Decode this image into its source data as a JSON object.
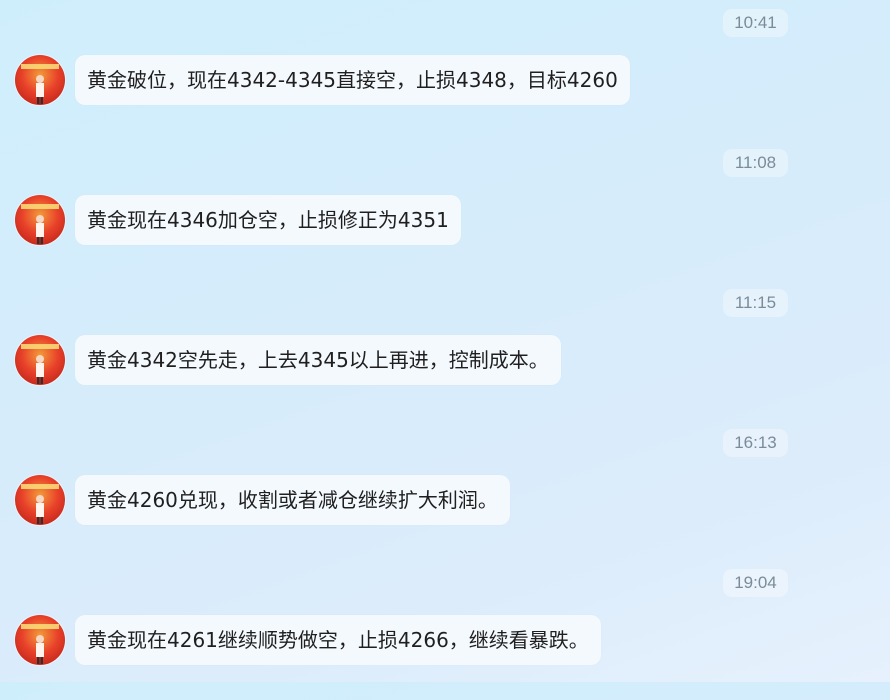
{
  "messages": [
    {
      "time": "10:41",
      "text": "黄金破位，现在4342-4345直接空，止损4348，目标4260"
    },
    {
      "time": "11:08",
      "text": "黄金现在4346加仓空，止损修正为4351"
    },
    {
      "time": "11:15",
      "text": "黄金4342空先走，上去4345以上再进，控制成本。"
    },
    {
      "time": "16:13",
      "text": "黄金4260兑现，收割或者减仓继续扩大利润。"
    },
    {
      "time": "19:04",
      "text": "黄金现在4261继续顺势做空，止损4266，继续看暴跌。"
    }
  ],
  "colors": {
    "background": "#d3ecfb",
    "bubble": "#f4f9fe",
    "timestamp_text": "#7a8c99",
    "avatar_red": "#e8412a"
  },
  "icons": {
    "avatar": "user-avatar-icon"
  }
}
